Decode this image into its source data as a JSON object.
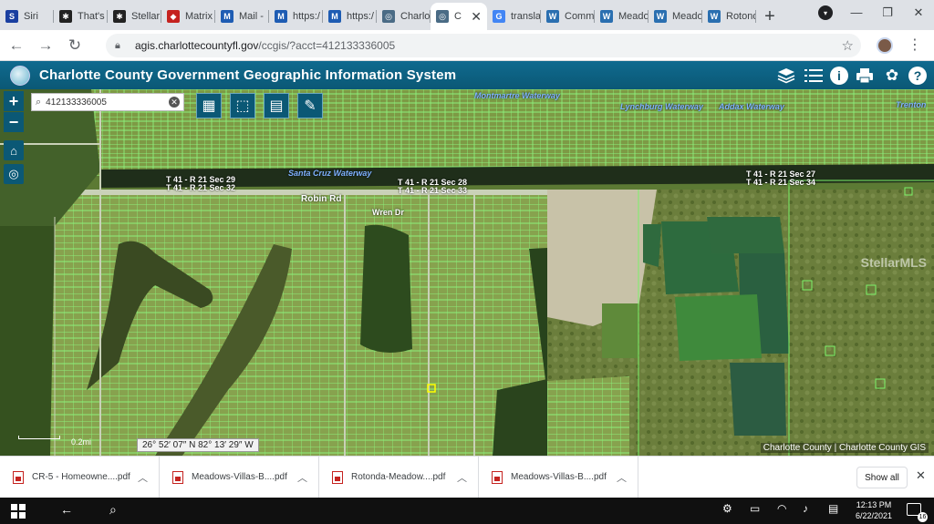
{
  "browser": {
    "tabs": [
      {
        "label": "Siri",
        "color": "#1a3fa0",
        "glyph": "S"
      },
      {
        "label": "That's",
        "color": "#222",
        "glyph": "✱"
      },
      {
        "label": "Stellar",
        "color": "#222",
        "glyph": "✱"
      },
      {
        "label": "Matrix",
        "color": "#c5221f",
        "glyph": "◆"
      },
      {
        "label": "Mail -",
        "color": "#1e5cb3",
        "glyph": "M"
      },
      {
        "label": "https:/",
        "color": "#1e5cb3",
        "glyph": "M"
      },
      {
        "label": "https:/",
        "color": "#1e5cb3",
        "glyph": "M"
      },
      {
        "label": "Charlot",
        "color": "#4a6b85",
        "glyph": "◎"
      },
      {
        "label": "C",
        "color": "#4a6b85",
        "glyph": "◎",
        "active": true
      },
      {
        "label": "translat",
        "color": "#4285f4",
        "glyph": "G"
      },
      {
        "label": "Comm",
        "color": "#2a6fb0",
        "glyph": "W"
      },
      {
        "label": "Meado",
        "color": "#2a6fb0",
        "glyph": "W"
      },
      {
        "label": "Meado",
        "color": "#2a6fb0",
        "glyph": "W"
      },
      {
        "label": "Rotond",
        "color": "#2a6fb0",
        "glyph": "W"
      }
    ],
    "newtab": "+",
    "url_host": "agis.charlottecountyfl.gov",
    "url_path": "/ccgis/?acct=412133336005",
    "window_controls": [
      "—",
      "❐",
      "✕"
    ]
  },
  "app": {
    "title": "Charlotte County Government Geographic Information System"
  },
  "map": {
    "search_value": "412133336005",
    "coords": "26° 52′ 07″ N 82° 13′ 29″ W",
    "scale": "0.2mi",
    "attribution": "Charlotte County | Charlotte County GIS",
    "watermark": "StellarMLS",
    "labels": {
      "robin": "Robin Rd",
      "wren": "Wren Dr",
      "santacruz": "Santa Cruz Waterway",
      "montmartre": "Montmartre Waterway",
      "lynchburg": "Lynchburg Waterway",
      "addax": "Addax Waterway",
      "trenton": "Trenton",
      "sec29": "T 41 - R 21 Sec 29",
      "sec32": "T 41 - R 21 Sec 32",
      "sec28": "T 41 - R 21 Sec 28",
      "sec33": "T 41 - R 21 Sec 33",
      "sec27": "T 41 - R 21 Sec 27",
      "sec34": "T 41 - R 21 Sec 34"
    }
  },
  "downloads": [
    {
      "name": "CR-5 - Homeowne....pdf"
    },
    {
      "name": "Meadows-Villas-B....pdf"
    },
    {
      "name": "Rotonda-Meadow....pdf"
    },
    {
      "name": "Meadows-Villas-B....pdf"
    }
  ],
  "downloads_showall": "Show all",
  "taskbar": {
    "time": "12:13 PM",
    "date": "6/22/2021",
    "notifications": "16"
  }
}
